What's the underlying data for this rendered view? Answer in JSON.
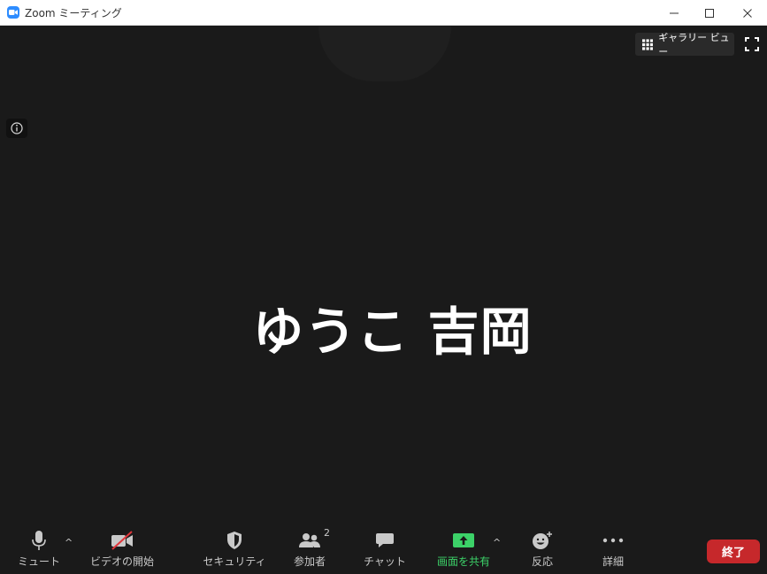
{
  "window": {
    "title": "Zoom ミーティング"
  },
  "view": {
    "gallery_label": "ギャラリー ビュー",
    "participant_name": "ゆうこ 吉岡"
  },
  "toolbar": {
    "mute_label": "ミュート",
    "video_label": "ビデオの開始",
    "security_label": "セキュリティ",
    "participants_label": "参加者",
    "participants_count": "2",
    "chat_label": "チャット",
    "share_label": "画面を共有",
    "reactions_label": "反応",
    "more_label": "詳細",
    "end_label": "終了"
  },
  "colors": {
    "background": "#1a1a1a",
    "share_green": "#3cd168",
    "end_red": "#c6282b",
    "zoom_blue": "#2d8cff"
  }
}
